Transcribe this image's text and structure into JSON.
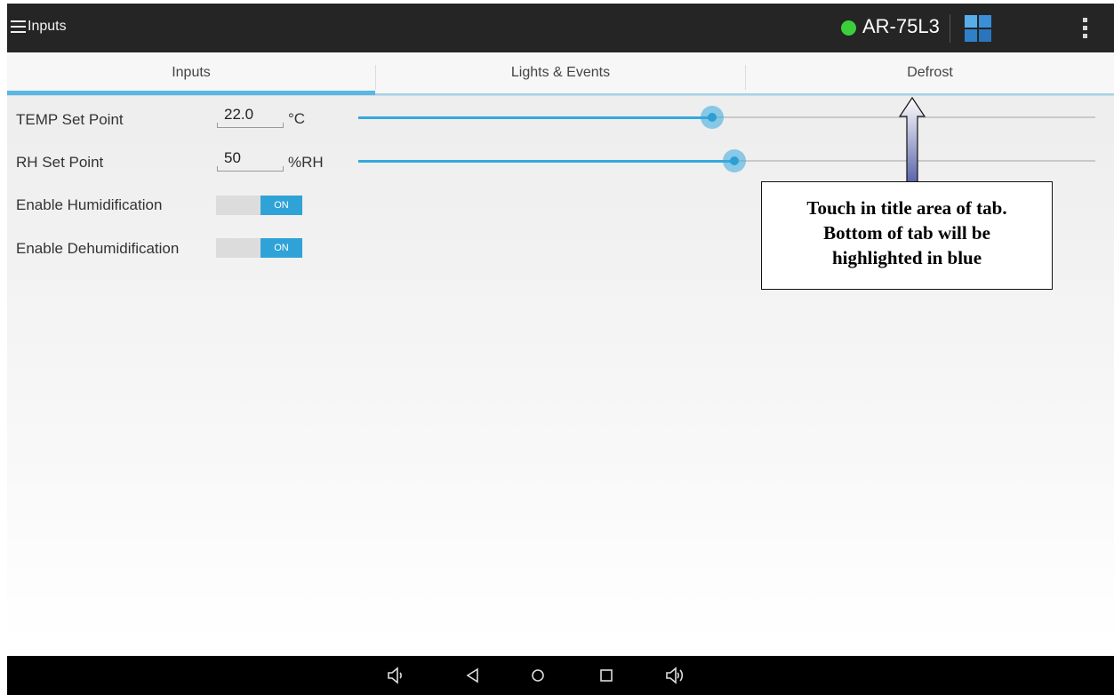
{
  "action_bar": {
    "title": "Inputs",
    "menu_icon": "hamburger-menu-icon",
    "status_color": "#3ccf3c",
    "device_name": "AR-75L3",
    "windows_icon": "windows-icon",
    "overflow_icon": "overflow-menu-icon"
  },
  "tabs": [
    {
      "label": "Inputs",
      "selected": true
    },
    {
      "label": "Lights & Events",
      "selected": false
    },
    {
      "label": "Defrost",
      "selected": false
    }
  ],
  "inputs": {
    "temp": {
      "label": "TEMP Set Point",
      "value": "22.0",
      "unit": "°C",
      "slider_fraction": 0.48
    },
    "rh": {
      "label": "RH Set Point",
      "value": "50",
      "unit": "%RH",
      "slider_fraction": 0.51
    },
    "humidification": {
      "label": "Enable Humidification",
      "state": "ON"
    },
    "dehumidification": {
      "label": "Enable Dehumidification",
      "state": "ON"
    }
  },
  "callout": {
    "lines": [
      "Touch in title area of tab.",
      "Bottom of tab will be",
      "highlighted in blue"
    ]
  },
  "nav_bar": {
    "icons": [
      "volume-down-icon",
      "back-icon",
      "home-icon",
      "recents-icon",
      "volume-up-icon"
    ]
  },
  "colors": {
    "accent": "#34a8de",
    "toggle_on": "#2fa3d7",
    "action_bar": "#252525"
  }
}
